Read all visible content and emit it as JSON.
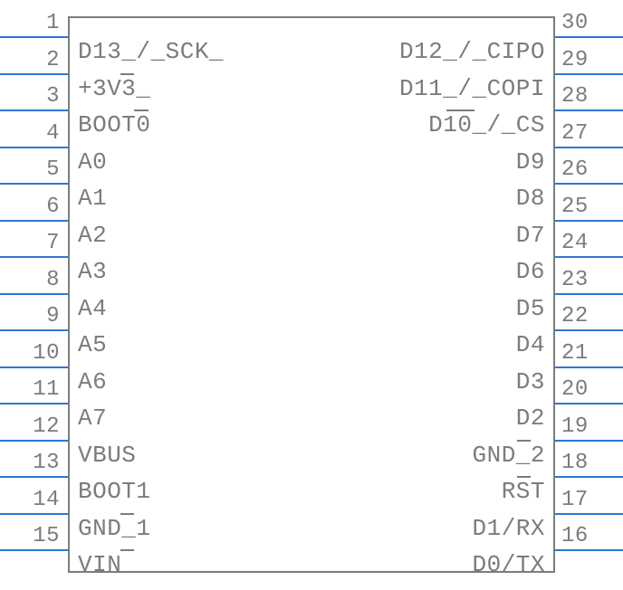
{
  "left_pins": [
    {
      "num": "1",
      "label": "D13_/_SCK_"
    },
    {
      "num": "2",
      "label": "+3V3_"
    },
    {
      "num": "3",
      "label": "BOOT0"
    },
    {
      "num": "4",
      "label": "A0"
    },
    {
      "num": "5",
      "label": "A1"
    },
    {
      "num": "6",
      "label": "A2"
    },
    {
      "num": "7",
      "label": "A3"
    },
    {
      "num": "8",
      "label": "A4"
    },
    {
      "num": "9",
      "label": "A5"
    },
    {
      "num": "10",
      "label": "A6"
    },
    {
      "num": "11",
      "label": "A7"
    },
    {
      "num": "12",
      "label": "VBUS"
    },
    {
      "num": "13",
      "label": "BOOT1"
    },
    {
      "num": "14",
      "label": "GND_1"
    },
    {
      "num": "15",
      "label": "VIN"
    }
  ],
  "right_pins": [
    {
      "num": "30",
      "label": "D12_/_CIPO"
    },
    {
      "num": "29",
      "label": "D11_/_COPI"
    },
    {
      "num": "28",
      "label": "D10_/_CS"
    },
    {
      "num": "27",
      "label": "D9"
    },
    {
      "num": "26",
      "label": "D8"
    },
    {
      "num": "25",
      "label": "D7"
    },
    {
      "num": "24",
      "label": "D6"
    },
    {
      "num": "23",
      "label": "D5"
    },
    {
      "num": "22",
      "label": "D4"
    },
    {
      "num": "21",
      "label": "D3"
    },
    {
      "num": "20",
      "label": "D2"
    },
    {
      "num": "19",
      "label": "GND_2"
    },
    {
      "num": "18",
      "label": "RST"
    },
    {
      "num": "17",
      "label": "D1/RX"
    },
    {
      "num": "16",
      "label": "D0/TX"
    }
  ],
  "bars": [
    {
      "side": "left",
      "row": 1,
      "offset_text": "+3V3",
      "over": "3"
    },
    {
      "side": "left",
      "row": 2,
      "offset_text": "BOOT",
      "over": "0"
    },
    {
      "side": "left",
      "row": 13,
      "offset_text": "GND",
      "over": "_"
    },
    {
      "side": "left",
      "row": 14,
      "offset_text": "VIN",
      "over": "‾",
      "skip": true
    },
    {
      "side": "right",
      "row": 2,
      "offset_text": "D10",
      "over": "10",
      "prefix": "D",
      "skip": true
    },
    {
      "side": "right",
      "row": 11,
      "offset_text": "GND",
      "over": "_",
      "prefix": "GND"
    },
    {
      "side": "right",
      "row": 12,
      "offset_text": "R",
      "over": "S",
      "prefix": "R"
    }
  ]
}
